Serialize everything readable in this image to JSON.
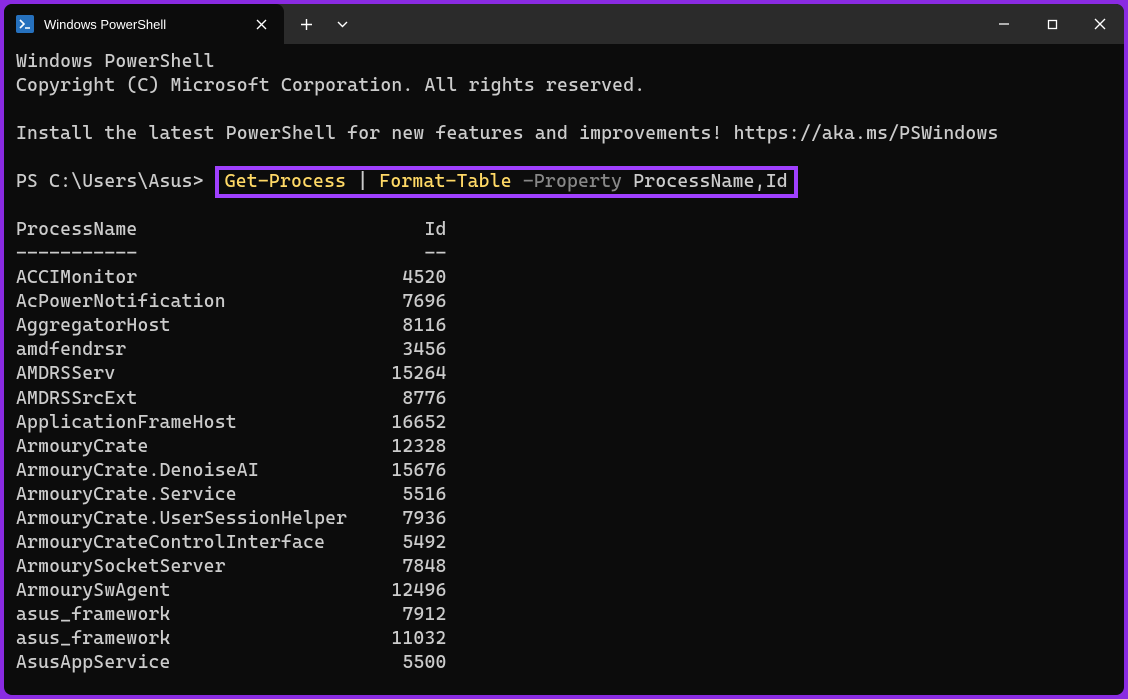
{
  "titlebar": {
    "tab_icon_glyph": ">_",
    "tab_title": "Windows PowerShell"
  },
  "header": {
    "line1": "Windows PowerShell",
    "line2": "Copyright (C) Microsoft Corporation. All rights reserved.",
    "install_msg": "Install the latest PowerShell for new features and improvements! https://aka.ms/PSWindows"
  },
  "prompt": {
    "prefix": "PS C:\\Users\\Asus> ",
    "cmd1": "Get-Process",
    "pipe": " | ",
    "cmd2": "Format-Table",
    "param": " -Property ",
    "args": "ProcessName,Id"
  },
  "table": {
    "col1_header": "ProcessName",
    "col2_header": "Id",
    "col1_width": 32,
    "col2_width": 6,
    "rows": [
      {
        "name": "ACCIMonitor",
        "id": 4520
      },
      {
        "name": "AcPowerNotification",
        "id": 7696
      },
      {
        "name": "AggregatorHost",
        "id": 8116
      },
      {
        "name": "amdfendrsr",
        "id": 3456
      },
      {
        "name": "AMDRSServ",
        "id": 15264
      },
      {
        "name": "AMDRSSrcExt",
        "id": 8776
      },
      {
        "name": "ApplicationFrameHost",
        "id": 16652
      },
      {
        "name": "ArmouryCrate",
        "id": 12328
      },
      {
        "name": "ArmouryCrate.DenoiseAI",
        "id": 15676
      },
      {
        "name": "ArmouryCrate.Service",
        "id": 5516
      },
      {
        "name": "ArmouryCrate.UserSessionHelper",
        "id": 7936
      },
      {
        "name": "ArmouryCrateControlInterface",
        "id": 5492
      },
      {
        "name": "ArmourySocketServer",
        "id": 7848
      },
      {
        "name": "ArmourySwAgent",
        "id": 12496
      },
      {
        "name": "asus_framework",
        "id": 7912
      },
      {
        "name": "asus_framework",
        "id": 11032
      },
      {
        "name": "AsusAppService",
        "id": 5500
      }
    ]
  }
}
